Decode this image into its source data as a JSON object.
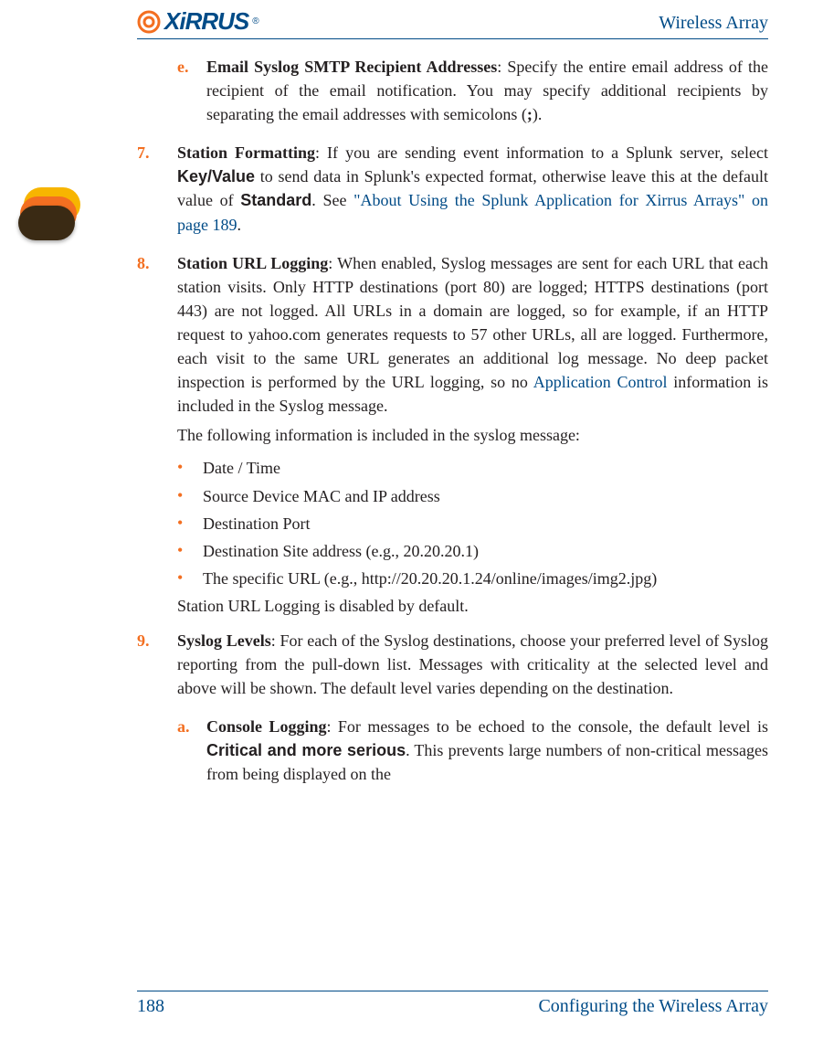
{
  "header": {
    "product": "Wireless Array",
    "logo_word": "XiRRUS",
    "logo_reg": "®"
  },
  "footer": {
    "page_number": "188",
    "section": "Configuring the Wireless Array"
  },
  "items": {
    "e": {
      "marker": "e.",
      "title": "Email Syslog SMTP Recipient Addresses",
      "text_after_title": ": Specify the entire email address of the recipient of the email notification. You may specify additional recipients by separating the email addresses with semicolons (",
      "semi_bold": ";",
      "text_tail": ")."
    },
    "n7": {
      "marker": "7.",
      "title": "Station Formatting",
      "t1": ": If you are sending event information to a Splunk server, select ",
      "kv": "Key/Value",
      "t2": " to send data in Splunk's expected format, otherwise leave this at the default value of ",
      "std": "Standard",
      "t3": ". See ",
      "link1": "\"About Using the Splunk Application for Xirrus Arrays\" on page 189",
      "t4": "."
    },
    "n8": {
      "marker": "8.",
      "title": "Station URL Logging",
      "t1": ": When enabled, Syslog messages are sent for each URL that each station visits. Only HTTP destinations (port 80) are logged; HTTPS destinations (port 443) are not logged. All URLs in a domain are logged, so for example, if an HTTP request to yahoo.com generates requests to 57 other URLs, all are logged. Furthermore, each visit to the same URL generates an additional log message. No deep packet inspection is performed by the URL logging, so no ",
      "link_app": "Application Control",
      "t2": " information is included in the Syslog message.",
      "intro": "The following information is included in the syslog message:",
      "bullets": [
        "Date / Time",
        "Source Device MAC and IP address",
        "Destination Port",
        "Destination Site address (e.g., 20.20.20.1)",
        "The specific URL (e.g., http://20.20.20.1.24/online/images/img2.jpg)"
      ],
      "disabled": "Station URL Logging is disabled by default."
    },
    "n9": {
      "marker": "9.",
      "title": "Syslog Levels",
      "t1": ": For each of the Syslog destinations, choose your preferred level of Syslog reporting from the pull-down list. Messages with criticality at the selected level and above will be shown. The default level varies depending on the destination."
    },
    "a": {
      "marker": "a.",
      "title": "Console Logging",
      "t1": ": For messages to be echoed to the console, the default level is ",
      "crit": "Critical and more serious",
      "t2": ". This prevents large numbers of non-critical messages from being displayed on the"
    }
  }
}
